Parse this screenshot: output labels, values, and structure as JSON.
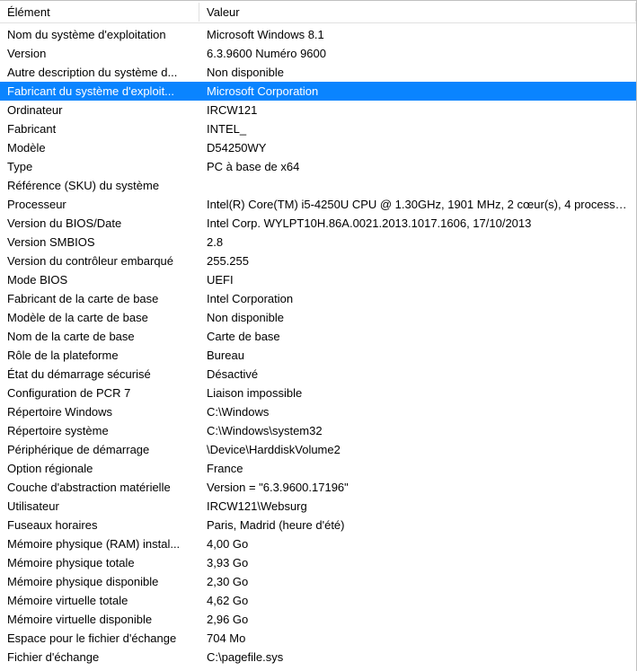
{
  "header": {
    "element": "Élément",
    "value": "Valeur"
  },
  "selected_index": 3,
  "rows": [
    {
      "label": "Nom du système d'exploitation",
      "value": "Microsoft Windows 8.1"
    },
    {
      "label": "Version",
      "value": "6.3.9600 Numéro 9600"
    },
    {
      "label": "Autre description du système d...",
      "value": "Non disponible"
    },
    {
      "label": "Fabricant du système d'exploit...",
      "value": "Microsoft Corporation"
    },
    {
      "label": "Ordinateur",
      "value": "IRCW121"
    },
    {
      "label": "Fabricant",
      "value": "INTEL_"
    },
    {
      "label": "Modèle",
      "value": "D54250WY"
    },
    {
      "label": "Type",
      "value": "PC à base de x64"
    },
    {
      "label": "Référence (SKU) du système",
      "value": ""
    },
    {
      "label": "Processeur",
      "value": "Intel(R) Core(TM) i5-4250U CPU @ 1.30GHz, 1901 MHz, 2 cœur(s), 4 processe..."
    },
    {
      "label": "Version du BIOS/Date",
      "value": "Intel Corp. WYLPT10H.86A.0021.2013.1017.1606, 17/10/2013"
    },
    {
      "label": "Version SMBIOS",
      "value": "2.8"
    },
    {
      "label": "Version du contrôleur embarqué",
      "value": "255.255"
    },
    {
      "label": "Mode BIOS",
      "value": "UEFI"
    },
    {
      "label": "Fabricant de la carte de base",
      "value": "Intel Corporation"
    },
    {
      "label": "Modèle de la carte de base",
      "value": "Non disponible"
    },
    {
      "label": "Nom de la carte de base",
      "value": "Carte de base"
    },
    {
      "label": "Rôle de la plateforme",
      "value": "Bureau"
    },
    {
      "label": "État du démarrage sécurisé",
      "value": "Désactivé"
    },
    {
      "label": "Configuration de PCR 7",
      "value": "Liaison impossible"
    },
    {
      "label": "Répertoire Windows",
      "value": "C:\\Windows"
    },
    {
      "label": "Répertoire système",
      "value": "C:\\Windows\\system32"
    },
    {
      "label": "Périphérique de démarrage",
      "value": "\\Device\\HarddiskVolume2"
    },
    {
      "label": "Option régionale",
      "value": "France"
    },
    {
      "label": "Couche d'abstraction matérielle",
      "value": "Version = \"6.3.9600.17196\""
    },
    {
      "label": "Utilisateur",
      "value": "IRCW121\\Websurg"
    },
    {
      "label": "Fuseaux horaires",
      "value": "Paris, Madrid (heure d'été)"
    },
    {
      "label": "Mémoire physique (RAM) instal...",
      "value": "4,00 Go"
    },
    {
      "label": "Mémoire physique totale",
      "value": "3,93 Go"
    },
    {
      "label": "Mémoire physique disponible",
      "value": "2,30 Go"
    },
    {
      "label": "Mémoire virtuelle totale",
      "value": "4,62 Go"
    },
    {
      "label": "Mémoire virtuelle disponible",
      "value": "2,96 Go"
    },
    {
      "label": "Espace pour le fichier d'échange",
      "value": "704 Mo"
    },
    {
      "label": "Fichier d'échange",
      "value": "C:\\pagefile.sys"
    }
  ]
}
